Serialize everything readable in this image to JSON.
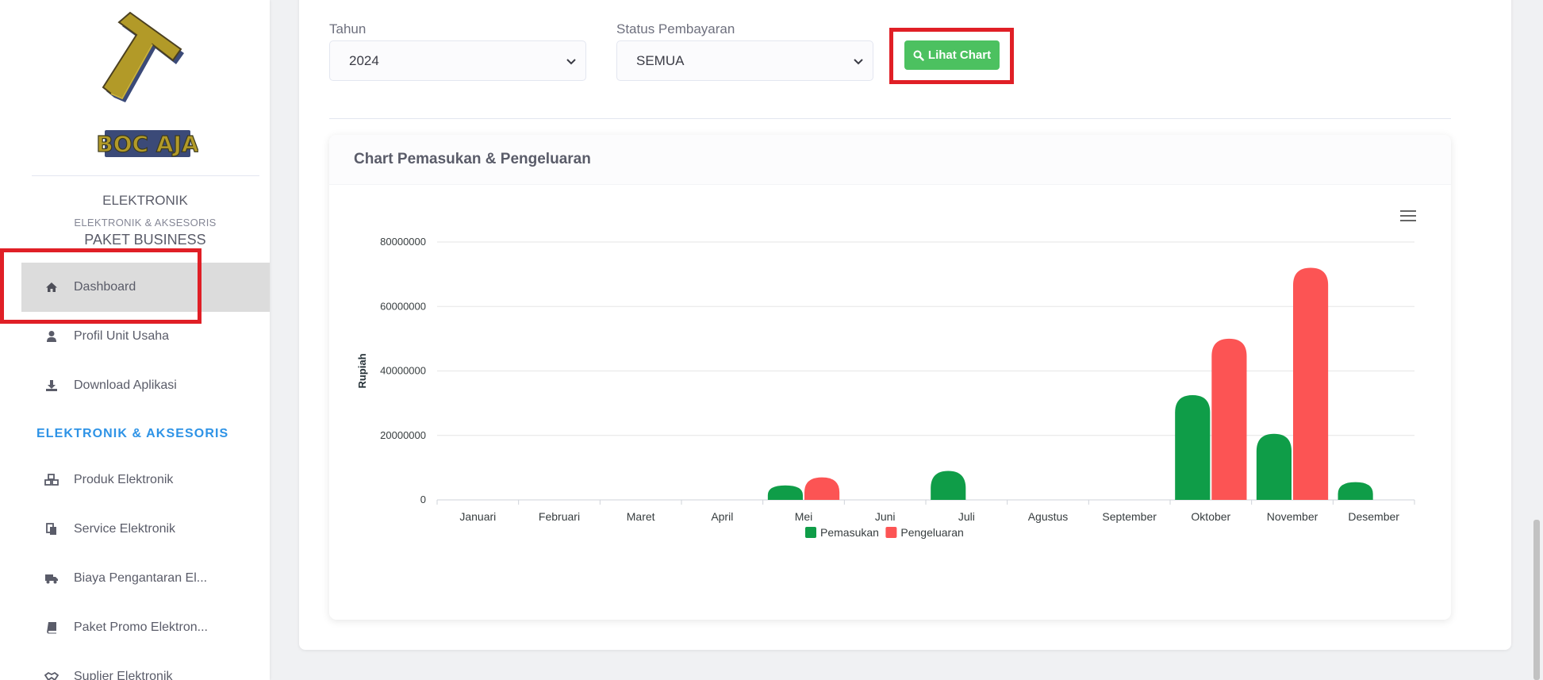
{
  "sidebar": {
    "logo_text": "BOC AJA",
    "business_type": "ELEKTRONIK",
    "business_category": "ELEKTRONIK & AKSESORIS",
    "plan": "PAKET BUSINESS",
    "items": [
      {
        "label": "Dashboard",
        "icon": "home-icon",
        "active": true
      },
      {
        "label": "Profil Unit Usaha",
        "icon": "user-icon"
      },
      {
        "label": "Download Aplikasi",
        "icon": "download-icon"
      }
    ],
    "section_heading": "ELEKTRONIK & AKSESORIS",
    "section_items": [
      {
        "label": "Produk Elektronik",
        "icon": "cubes-icon"
      },
      {
        "label": "Service Elektronik",
        "icon": "copy-icon"
      },
      {
        "label": "Biaya Pengantaran El...",
        "icon": "truck-icon"
      },
      {
        "label": "Paket Promo Elektron...",
        "icon": "book-icon"
      },
      {
        "label": "Suplier Elektronik",
        "icon": "handshake-icon"
      }
    ]
  },
  "filters": {
    "year_label": "Tahun",
    "year_value": "2024",
    "status_label": "Status Pembayaran",
    "status_value": "SEMUA",
    "button_label": "Lihat Chart",
    "button_icon": "search-icon"
  },
  "chart_card": {
    "title": "Chart Pemasukan & Pengeluaran",
    "menu_icon": "hamburger-menu-icon"
  },
  "colors": {
    "income": "#0f9d48",
    "expense": "#fc5454",
    "accent": "#2e93e6",
    "button": "#4cc160",
    "highlight": "#e01f26"
  },
  "chart_data": {
    "type": "bar",
    "ylabel": "Rupiah",
    "xlabel": "",
    "ylim": [
      0,
      80000000
    ],
    "yticks": [
      "0",
      "20000000",
      "40000000",
      "60000000",
      "80000000"
    ],
    "categories": [
      "Januari",
      "Februari",
      "Maret",
      "April",
      "Mei",
      "Juni",
      "Juli",
      "Agustus",
      "September",
      "Oktober",
      "November",
      "Desember"
    ],
    "series": [
      {
        "name": "Pemasukan",
        "color": "#0f9d48",
        "values": [
          0,
          0,
          0,
          0,
          4500000,
          0,
          9000000,
          0,
          0,
          32500000,
          20500000,
          5500000
        ]
      },
      {
        "name": "Pengeluaran",
        "color": "#fc5454",
        "values": [
          0,
          0,
          0,
          0,
          7000000,
          0,
          0,
          0,
          0,
          50000000,
          72000000,
          0
        ]
      }
    ],
    "legend_position": "bottom-center",
    "grid": true
  }
}
